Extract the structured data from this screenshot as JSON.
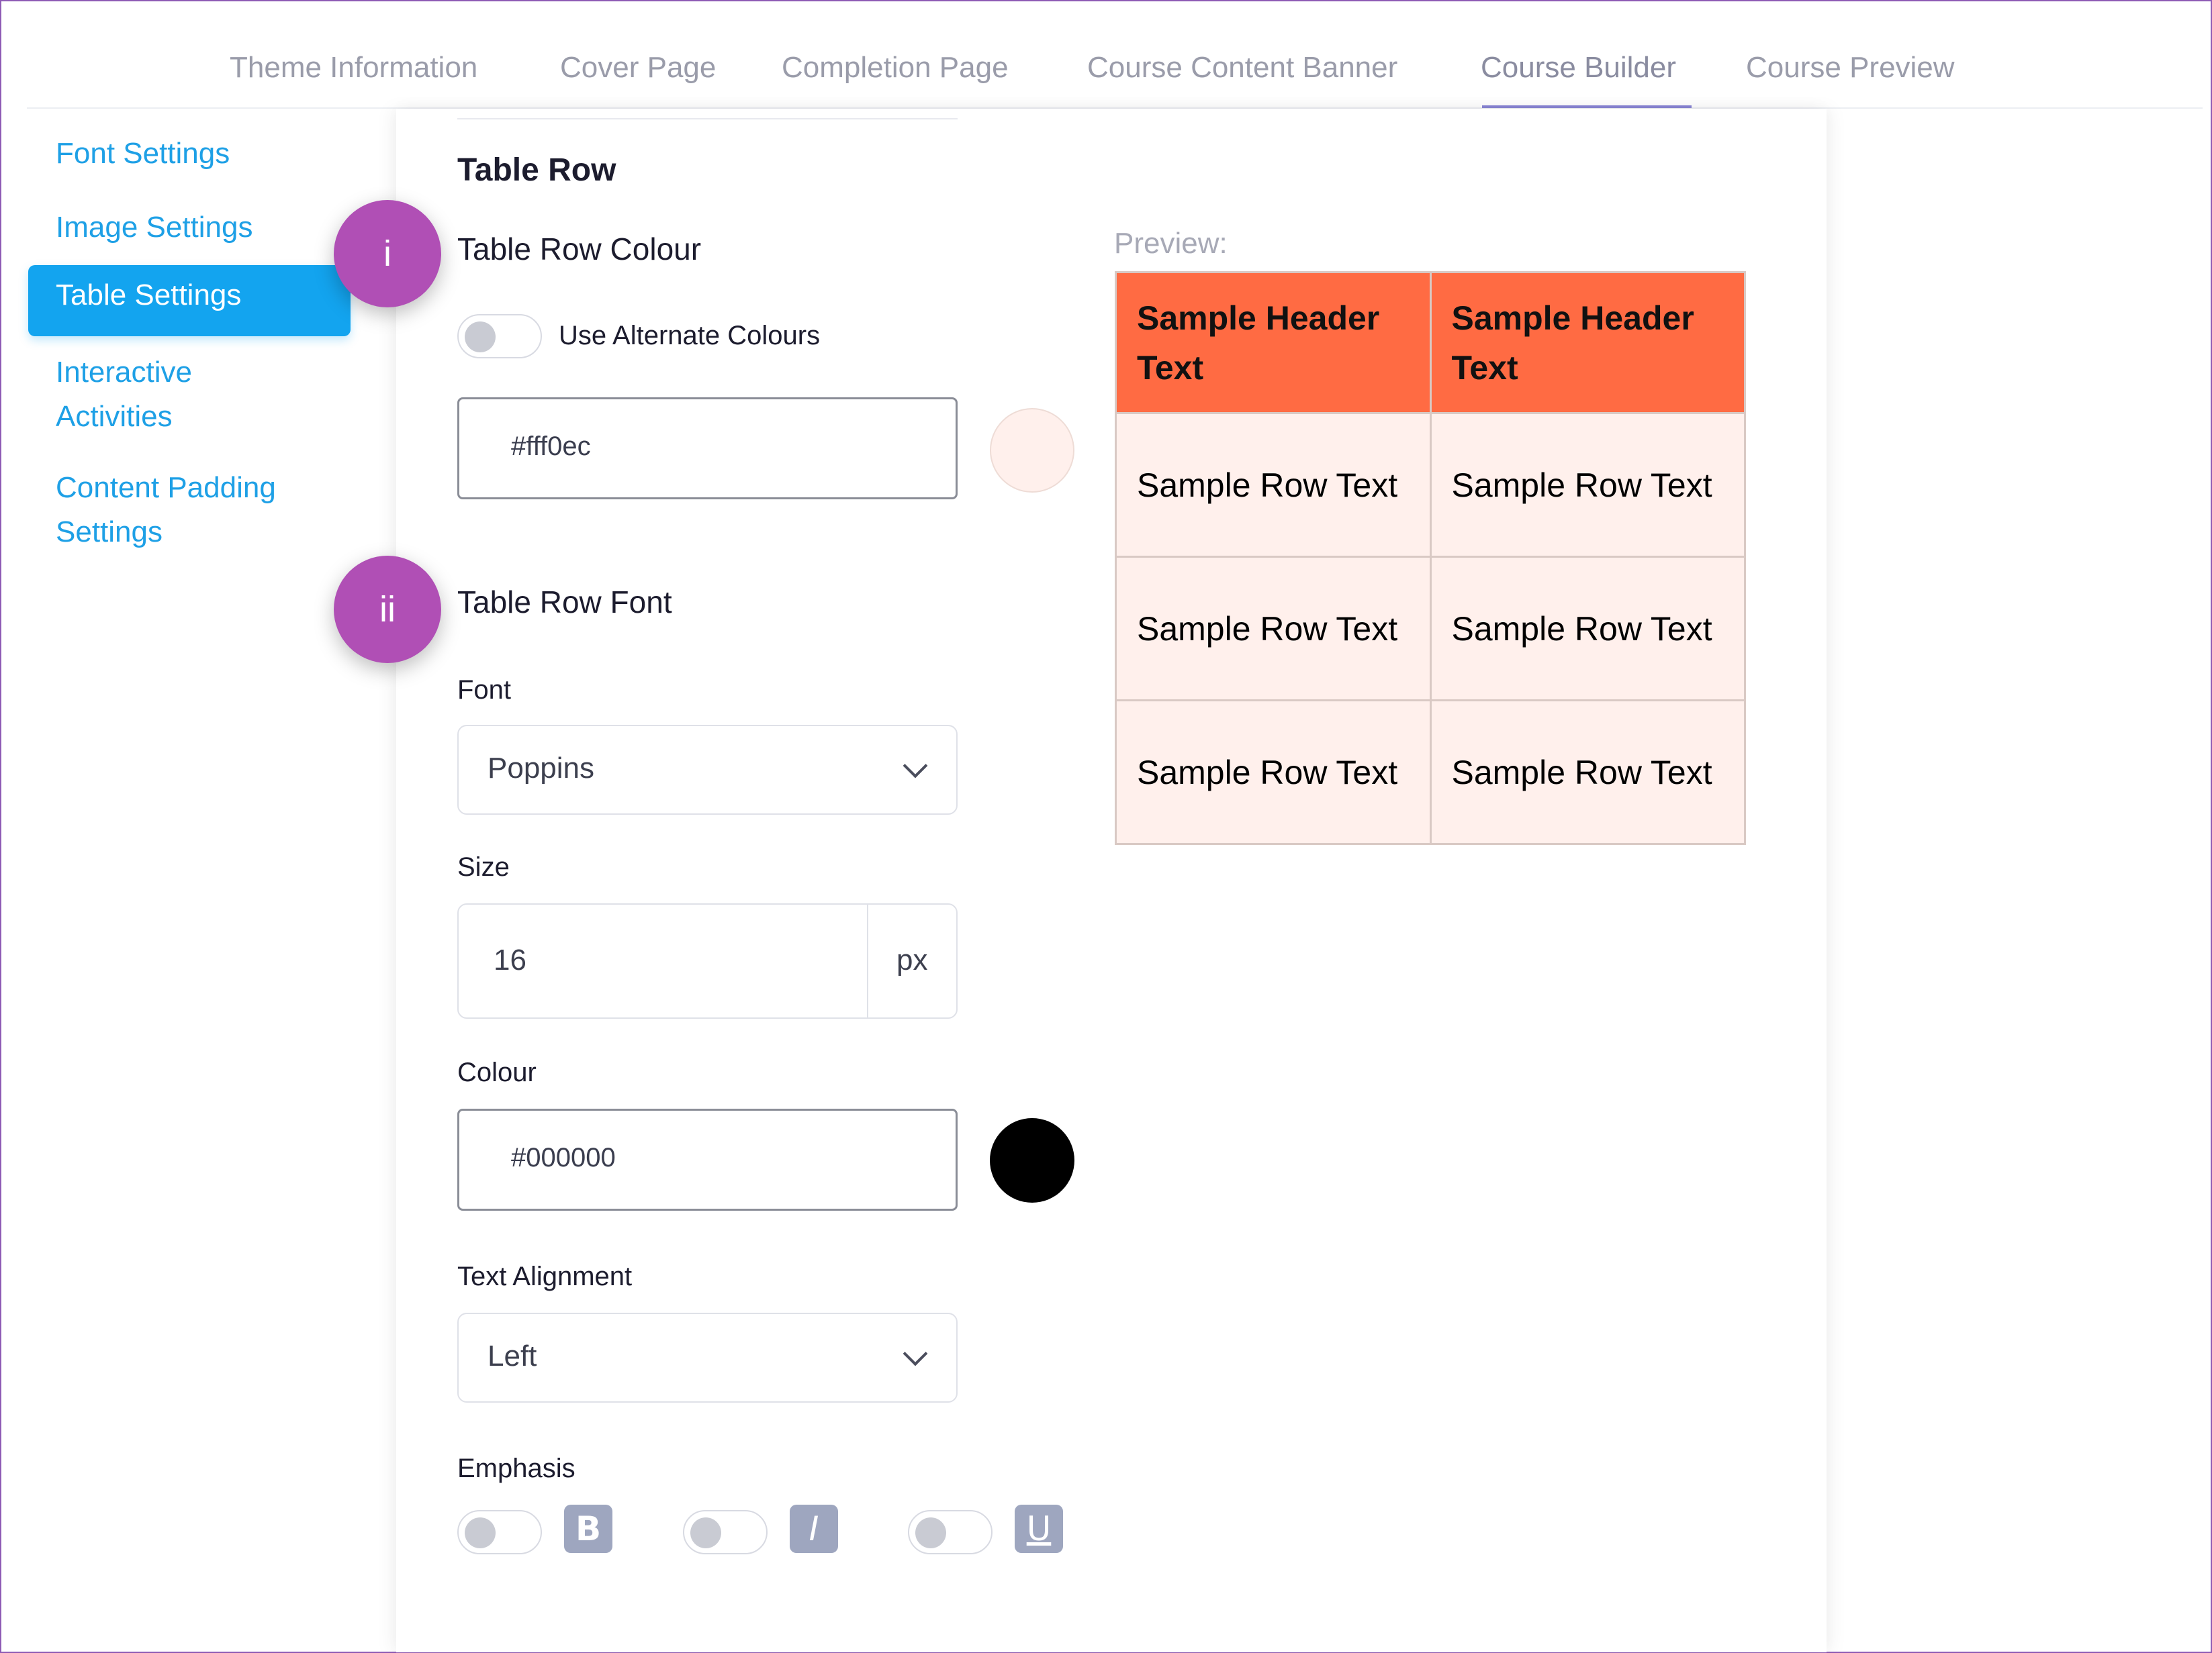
{
  "tabs": [
    {
      "label": "Theme Information"
    },
    {
      "label": "Cover Page"
    },
    {
      "label": "Completion Page"
    },
    {
      "label": "Course Content Banner"
    },
    {
      "label": "Course Builder"
    },
    {
      "label": "Course Preview"
    }
  ],
  "active_tab": "Course Builder",
  "sidebar": {
    "items": [
      {
        "label": "Font Settings"
      },
      {
        "label": "Image Settings"
      },
      {
        "label": "Table Settings"
      },
      {
        "label": "Interactive Activities"
      },
      {
        "label": "Content Padding Settings"
      }
    ],
    "active": "Table Settings"
  },
  "section": {
    "title": "Table Row",
    "badges": [
      "i",
      "ii"
    ],
    "row_colour": {
      "heading": "Table Row Colour",
      "alternate_label": "Use Alternate Colours",
      "alternate_on": false,
      "hex": "#fff0ec"
    },
    "row_font": {
      "heading": "Table Row Font",
      "font_label": "Font",
      "font_value": "Poppins",
      "size_label": "Size",
      "size_value": "16",
      "size_unit": "px",
      "colour_label": "Colour",
      "colour_hex": "#000000",
      "alignment_label": "Text Alignment",
      "alignment_value": "Left",
      "emphasis_label": "Emphasis",
      "emphasis": [
        {
          "glyph": "B",
          "on": false
        },
        {
          "glyph": "I",
          "on": false
        },
        {
          "glyph": "U",
          "on": false
        }
      ]
    }
  },
  "preview": {
    "label": "Preview:",
    "header": [
      "Sample Header Text",
      "Sample Header Text"
    ],
    "rows": [
      [
        "Sample Row Text",
        "Sample Row Text"
      ],
      [
        "Sample Row Text",
        "Sample Row Text"
      ],
      [
        "Sample Row Text",
        "Sample Row Text"
      ]
    ]
  },
  "colors": {
    "accent": "#13a4ef",
    "badge": "#b04fb5",
    "header_bg": "#ff6b43",
    "row_bg": "#fff0ec",
    "frame": "#8e5bb5"
  }
}
